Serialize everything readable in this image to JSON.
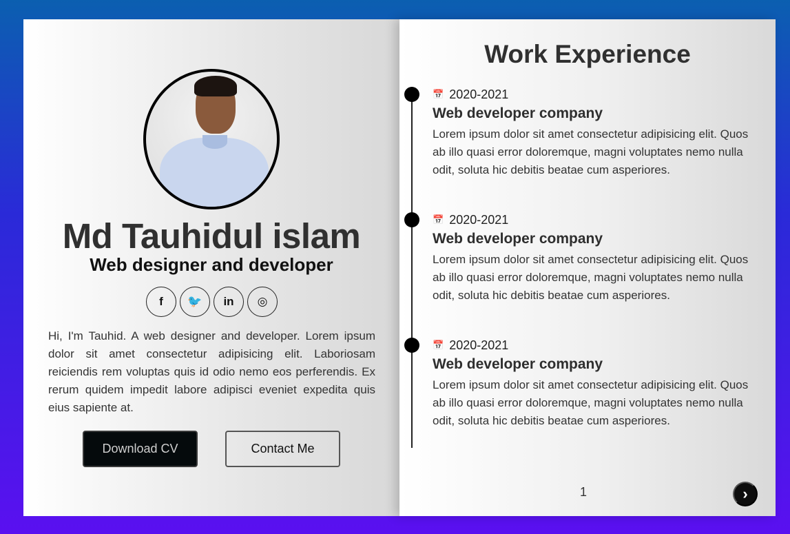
{
  "profile": {
    "name": "Md Tauhidul islam",
    "role": "Web designer and developer",
    "bio": "Hi, I'm Tauhid. A web designer and developer. Lorem ipsum dolor sit amet consectetur adipisicing elit. Laboriosam reiciendis rem voluptas quis id odio nemo eos perferendis. Ex rerum quidem impedit labore adipisci eveniet expedita quis eius sapiente at.",
    "socials": [
      {
        "icon": "facebook-icon",
        "glyph": "f"
      },
      {
        "icon": "twitter-icon",
        "glyph": "🐦"
      },
      {
        "icon": "linkedin-icon",
        "glyph": "in"
      },
      {
        "icon": "instagram-icon",
        "glyph": "◎"
      }
    ],
    "buttons": {
      "download_label": "Download CV",
      "contact_label": "Contact Me"
    }
  },
  "experience": {
    "title": "Work Experience",
    "entries": [
      {
        "date": "2020-2021",
        "company": "Web developer company",
        "description": "Lorem ipsum dolor sit amet consectetur adipisicing elit. Quos ab illo quasi error doloremque, magni voluptates nemo nulla odit, soluta hic debitis beatae cum asperiores."
      },
      {
        "date": "2020-2021",
        "company": "Web developer company",
        "description": "Lorem ipsum dolor sit amet consectetur adipisicing elit. Quos ab illo quasi error doloremque, magni voluptates nemo nulla odit, soluta hic debitis beatae cum asperiores."
      },
      {
        "date": "2020-2021",
        "company": "Web developer company",
        "description": "Lorem ipsum dolor sit amet consectetur adipisicing elit. Quos ab illo quasi error doloremque, magni voluptates nemo nulla odit, soluta hic debitis beatae cum asperiores."
      }
    ],
    "page_number": "1",
    "next_icon": "chevron-right-icon",
    "next_glyph": "›"
  },
  "colors": {
    "background_top": "#0b5fb0",
    "background_bottom": "#5a10f0",
    "download_button": "#050a0c",
    "text": "#333333"
  }
}
